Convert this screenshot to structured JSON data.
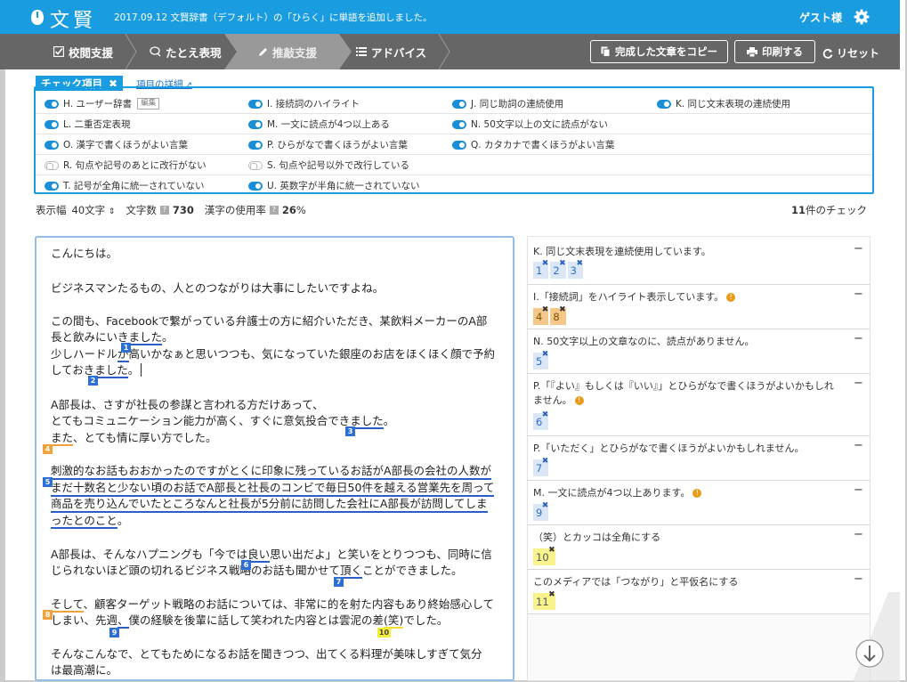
{
  "app": {
    "title": "文賢",
    "notice": "2017.09.12 文賢辞書（デフォルト）の「ひらく」に単語を追加しました。",
    "user": "ゲスト様"
  },
  "nav": {
    "tabs": [
      "校閲支援",
      "たとえ表現",
      "推敲支援",
      "アドバイス"
    ],
    "copy_label": "完成した文章をコピー",
    "print_label": "印刷する",
    "reset_label": "リセット"
  },
  "checks": {
    "title": "チェック項目",
    "detail_link": "項目の詳細",
    "edit_badge": "編集",
    "rows": [
      [
        {
          "label": "H. ユーザー辞書",
          "on": true
        },
        {
          "label": "I. 接続詞のハイライト",
          "on": true
        },
        {
          "label": "J. 同じ助詞の連続使用",
          "on": true
        },
        {
          "label": "K. 同じ文末表現の連続使用",
          "on": true
        }
      ],
      [
        {
          "label": "L. 二重否定表現",
          "on": true
        },
        {
          "label": "M. 一文に読点が4つ以上ある",
          "on": true
        },
        {
          "label": "N. 50文字以上の文に読点がない",
          "on": true
        }
      ],
      [
        {
          "label": "O. 漢字で書くほうがよい言葉",
          "on": true
        },
        {
          "label": "P. ひらがなで書くほうがよい言葉",
          "on": true
        },
        {
          "label": "Q. カタカナで書くほうがよい言葉",
          "on": true
        }
      ],
      [
        {
          "label": "R. 句点や記号のあとに改行がない",
          "on": false
        },
        {
          "label": "S. 句点や記号以外で改行している",
          "on": false
        }
      ],
      [
        {
          "label": "T. 記号が全角に統一されていない",
          "on": true
        },
        {
          "label": "U. 英数字が半角に統一されていない",
          "on": true
        }
      ]
    ]
  },
  "stats": {
    "width_label": "表示幅",
    "width_value": "40文字",
    "chars_label": "文字数",
    "chars_value": "730",
    "kanji_label": "漢字の使用率",
    "kanji_value": "26",
    "kanji_unit": "%",
    "count_value": "11",
    "count_suffix": "件のチェック"
  },
  "editor": {
    "l1": "こんにちは。",
    "l2": "ビジネスマンたるもの、人とのつながりは大事にしたいですよね。",
    "l3": "この間も、Facebookで繋がっている弁護士の方に紹介いただき、某飲料メーカーのA部",
    "l4a": "長と飲みにいき",
    "l4b": "ました",
    "l4c": "。",
    "l5a": "少しハードル",
    "l5b": "が",
    "l5c": "高いかなぁと思いつつも、気になっていた銀座のお店をほくほく顔で予約",
    "l6a": "しておき",
    "l6b": "ました",
    "l6c": "。",
    "l7": "A部長は、さすが社長の参謀と言われる方だけあって、",
    "l8a": "とてもコミュニケーション能力が高く、すぐに意気投合でき",
    "l8b": "ました",
    "l8c": "。",
    "l9a": "また",
    "l9b": "、とても情に厚い方でした。",
    "l10": "刺激的なお話もおおかったのですがとくに印象に残っているお話がA部長の会社の人数が",
    "l11": "まだ十数名と少ない頃のお話でA部長と社長のコンビで毎日50件を越える営業先を周って",
    "l12": "商品を売り込んでいたところなんと社長が5分前に訪問した会社にA部長が訪問してしま",
    "l13": "ったとのこと",
    "l13b": "。",
    "l14a": "A部長は、そんなハプニングも「今では",
    "l14b": "良い",
    "l14c": "思い出だよ」と笑いをとりつつも、同時に信",
    "l15a": "じられないほど頭の切れるビジネス戦略のお話も聞かせて",
    "l15b": "頂く",
    "l15c": "ことができました。",
    "l16a": "そして",
    "l16b": "、顧客ターゲット戦略のお話については、非常に的を射た内容もあり終始感心して",
    "l17a": "しまい、先週",
    "l17b": "、",
    "l17c": "僕の経験を後輩に話して笑われた内容とは雲泥の差",
    "l17d": "(笑)",
    "l17e": "でした。",
    "l18": "そんなこんなで、とてもためになるお話を聞きつつ、出てくる料理が美味しすぎて気分",
    "l19": "は最高潮に。",
    "markers": [
      "1",
      "2",
      "3",
      "4",
      "5",
      "6",
      "7",
      "8",
      "9",
      "10"
    ]
  },
  "advice": [
    {
      "title": "K. 同じ文末表現を連続使用しています。",
      "tags": [
        "1",
        "2",
        "3"
      ],
      "color": "blue",
      "info": false
    },
    {
      "title": "I.「接続詞」をハイライト表示しています。",
      "tags": [
        "4",
        "8"
      ],
      "color": "orange",
      "info": true
    },
    {
      "title": "N. 50文字以上の文章なのに、読点がありません。",
      "tags": [
        "5"
      ],
      "color": "blue",
      "info": false
    },
    {
      "title": "P.「『よい』もしくは『いい』」とひらがなで書くほうがよいかもしれません。",
      "tags": [
        "6"
      ],
      "color": "blue",
      "info": true
    },
    {
      "title": "P.「いただく」とひらがなで書くほうがよいかもしれません。",
      "tags": [
        "7"
      ],
      "color": "blue",
      "info": false
    },
    {
      "title": "M. 一文に読点が4つ以上あります。",
      "tags": [
        "9"
      ],
      "color": "blue",
      "info": true
    },
    {
      "title": "（笑）とカッコは全角にする",
      "tags": [
        "10"
      ],
      "color": "yellow",
      "info": false
    },
    {
      "title": "このメディアでは「つながり」と平仮名にする",
      "tags": [
        "11"
      ],
      "color": "yellow",
      "info": false
    }
  ],
  "colors": {
    "brand": "#1a9de0",
    "nav": "#666666",
    "blue_mark": "#2c6fd6",
    "orange_mark": "#f0a23c",
    "yellow_mark": "#f5ec36"
  },
  "icons": [
    "logo-icon",
    "gear-icon",
    "check-square-icon",
    "speech-icon",
    "pencil-icon",
    "list-icon",
    "copy-icon",
    "print-icon",
    "refresh-icon",
    "close-icon",
    "external-link-icon",
    "info-icon",
    "arrow-down-icon"
  ]
}
